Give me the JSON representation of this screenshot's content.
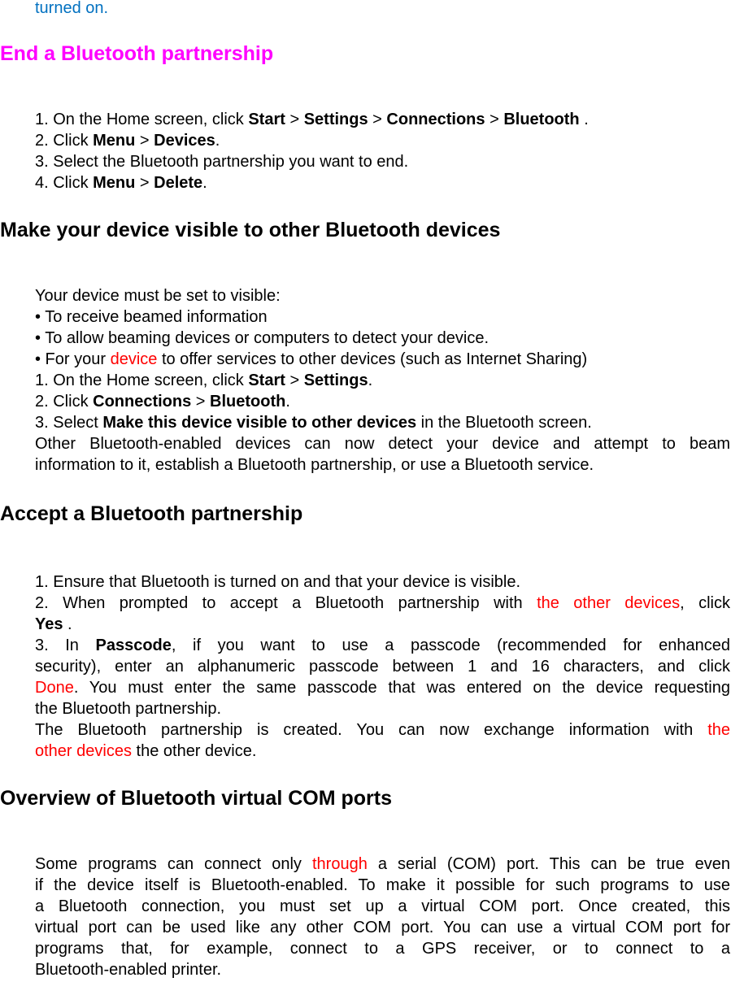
{
  "colors": {
    "link_blue": "#0070c0",
    "heading_magenta": "#ff00ff",
    "highlight_red": "#ff0000",
    "text": "#000000"
  },
  "intro_tail": "turned on.",
  "sections": {
    "end": {
      "title": "End a Bluetooth partnership",
      "step1": {
        "pre": "1. On the Home screen, click ",
        "start": "Start",
        "gt1": " > ",
        "settings": "Settings",
        "gt2": " > ",
        "connections": "Connections",
        "gt3": " > ",
        "bluetooth": "Bluetooth",
        "post": " ."
      },
      "step2": {
        "pre": "2. Click ",
        "menu": "Menu",
        "gt": " > ",
        "devices": "Devices",
        "post": "."
      },
      "step3": "3. Select the Bluetooth partnership you want to end.",
      "step4": {
        "pre": "4. Click ",
        "menu": "Menu",
        "gt": " > ",
        "delete": "Delete",
        "post": "."
      }
    },
    "visible": {
      "title": "Make your device visible to other Bluetooth devices",
      "lead": "Your device must be set to visible:",
      "bullet1": "• To receive beamed information",
      "bullet2": "• To allow beaming devices or computers to detect your device.",
      "bullet3": {
        "pre": "• For your ",
        "red": "device",
        "post": " to offer services to other devices (such as Internet Sharing)"
      },
      "step1": {
        "pre": "1. On the Home screen, click ",
        "start": "Start",
        "gt": " > ",
        "settings": "Settings",
        "post": "."
      },
      "step2": {
        "pre": "2. Click ",
        "connections": "Connections",
        "gt": " > ",
        "bluetooth": "Bluetooth",
        "post": "."
      },
      "step3": {
        "pre": "3. Select ",
        "bold": "Make this device visible to other devices",
        "post": " in the Bluetooth screen."
      },
      "result_line1": "Other Bluetooth-enabled devices can now detect your device and attempt to beam",
      "result_line2": "information to it, establish a Bluetooth partnership, or use a Bluetooth service."
    },
    "accept": {
      "title": "Accept a Bluetooth partnership",
      "step1": "1. Ensure that Bluetooth is turned on and that your device is visible.",
      "step2": {
        "pre": "2. When prompted to accept a Bluetooth partnership with ",
        "red": "the other devices",
        "post": ", click",
        "yes": "Yes",
        "yes_post": " ."
      },
      "step3": {
        "pre": "3. In ",
        "passcode": "Passcode",
        "l1_post": ", if you want to use a passcode (recommended for enhanced",
        "l2": "security), enter an alphanumeric passcode between 1 and 16 characters, and click",
        "done": "Done",
        "l3_post": ". You must enter the same passcode that was entered on the device requesting",
        "l4": "the Bluetooth partnership."
      },
      "result": {
        "l1": "The Bluetooth partnership is created. You can now exchange information with ",
        "red1": "the",
        "red2": "other devices",
        "l2_post": " the other device."
      }
    },
    "com": {
      "title": "Overview of Bluetooth virtual COM ports",
      "l1": {
        "pre": "Some programs can connect only ",
        "red": "through",
        "post": " a serial (COM) port. This can be true even"
      },
      "l2": "if the device itself is Bluetooth-enabled. To make it possible for such programs to use",
      "l3": "a Bluetooth connection, you must set up a virtual COM port. Once created, this",
      "l4": "virtual port can be used like any other COM port. You can use a virtual COM port for",
      "l5": "programs that, for example, connect to a GPS receiver, or to connect to a",
      "l6": "Bluetooth-enabled printer."
    }
  }
}
